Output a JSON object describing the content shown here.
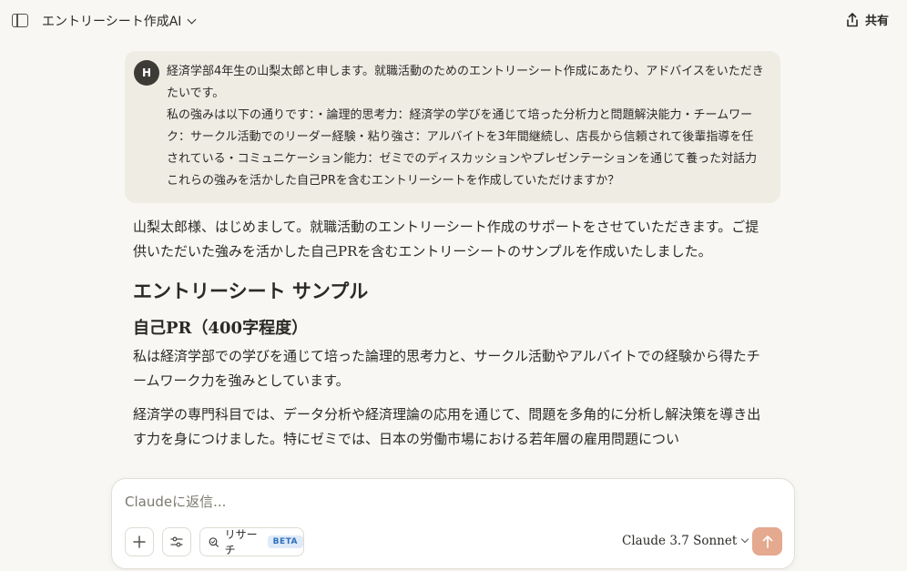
{
  "header": {
    "title": "エントリーシート作成AI",
    "share_label": "共有"
  },
  "user_message": {
    "avatar_initial": "H",
    "lines": [
      "経済学部4年生の山梨太郎と申します。就職活動のためのエントリーシート作成にあたり、アドバイスをいただきたいです。",
      "私の強みは以下の通りです：・論理的思考力：経済学の学びを通じて培った分析力と問題解決能力・チームワーク：サークル活動でのリーダー経験・粘り強さ：アルバイトを3年間継続し、店長から信頼されて後輩指導を任されている・コミュニケーション能力：ゼミでのディスカッションやプレゼンテーションを通じて養った対話力",
      "これらの強みを活かした自己PRを含むエントリーシートを作成していただけますか？"
    ]
  },
  "assistant": {
    "intro": "山梨太郎様、はじめまして。就職活動のエントリーシート作成のサポートをさせていただきます。ご提供いただいた強みを活かした自己PRを含むエントリーシートのサンプルを作成いたしました。",
    "heading": "エントリーシート サンプル",
    "subheading": "自己PR（400字程度）",
    "para1": "私は経済学部での学びを通じて培った論理的思考力と、サークル活動やアルバイトでの経験から得たチームワーク力を強みとしています。",
    "para2": "経済学の専門科目では、データ分析や経済理論の応用を通じて、問題を多角的に分析し解決策を導き出す力を身につけました。特にゼミでは、日本の労働市場における若年層の雇用問題につい"
  },
  "composer": {
    "placeholder": "Claudeに返信...",
    "research_label": "リサーチ",
    "beta_label": "BETA",
    "model_label": "Claude 3.7 Sonnet"
  },
  "colors": {
    "background": "#f8f7f3",
    "user_bubble": "#efece4",
    "send_button": "#e4a98f",
    "beta_bg": "#dfeaf8",
    "beta_text": "#2f6fbf"
  },
  "icons": [
    "sidebar-toggle-icon",
    "chevron-down-icon",
    "share-icon",
    "plus-icon",
    "sliders-icon",
    "research-search-icon",
    "send-arrow-icon"
  ]
}
